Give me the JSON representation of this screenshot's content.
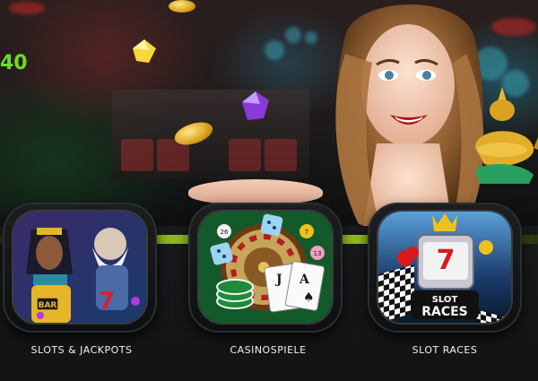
{
  "hero": {
    "counter_text": "40"
  },
  "categories": [
    {
      "label": "SLOTS & JACKPOTS",
      "icon": "egyptian-queen-and-zeus-icon"
    },
    {
      "label": "CASINOSPIELE",
      "icon": "roulette-and-cards-icon"
    },
    {
      "label": "SLOT RACES",
      "icon": "slot-machine-races-icon"
    }
  ],
  "slot_races_badge": {
    "line1": "SLOT",
    "line2": "RACES"
  },
  "colors": {
    "accent_green": "#9fd01a",
    "counter_green": "#6cdb2a",
    "background": "#0b0d0f"
  }
}
